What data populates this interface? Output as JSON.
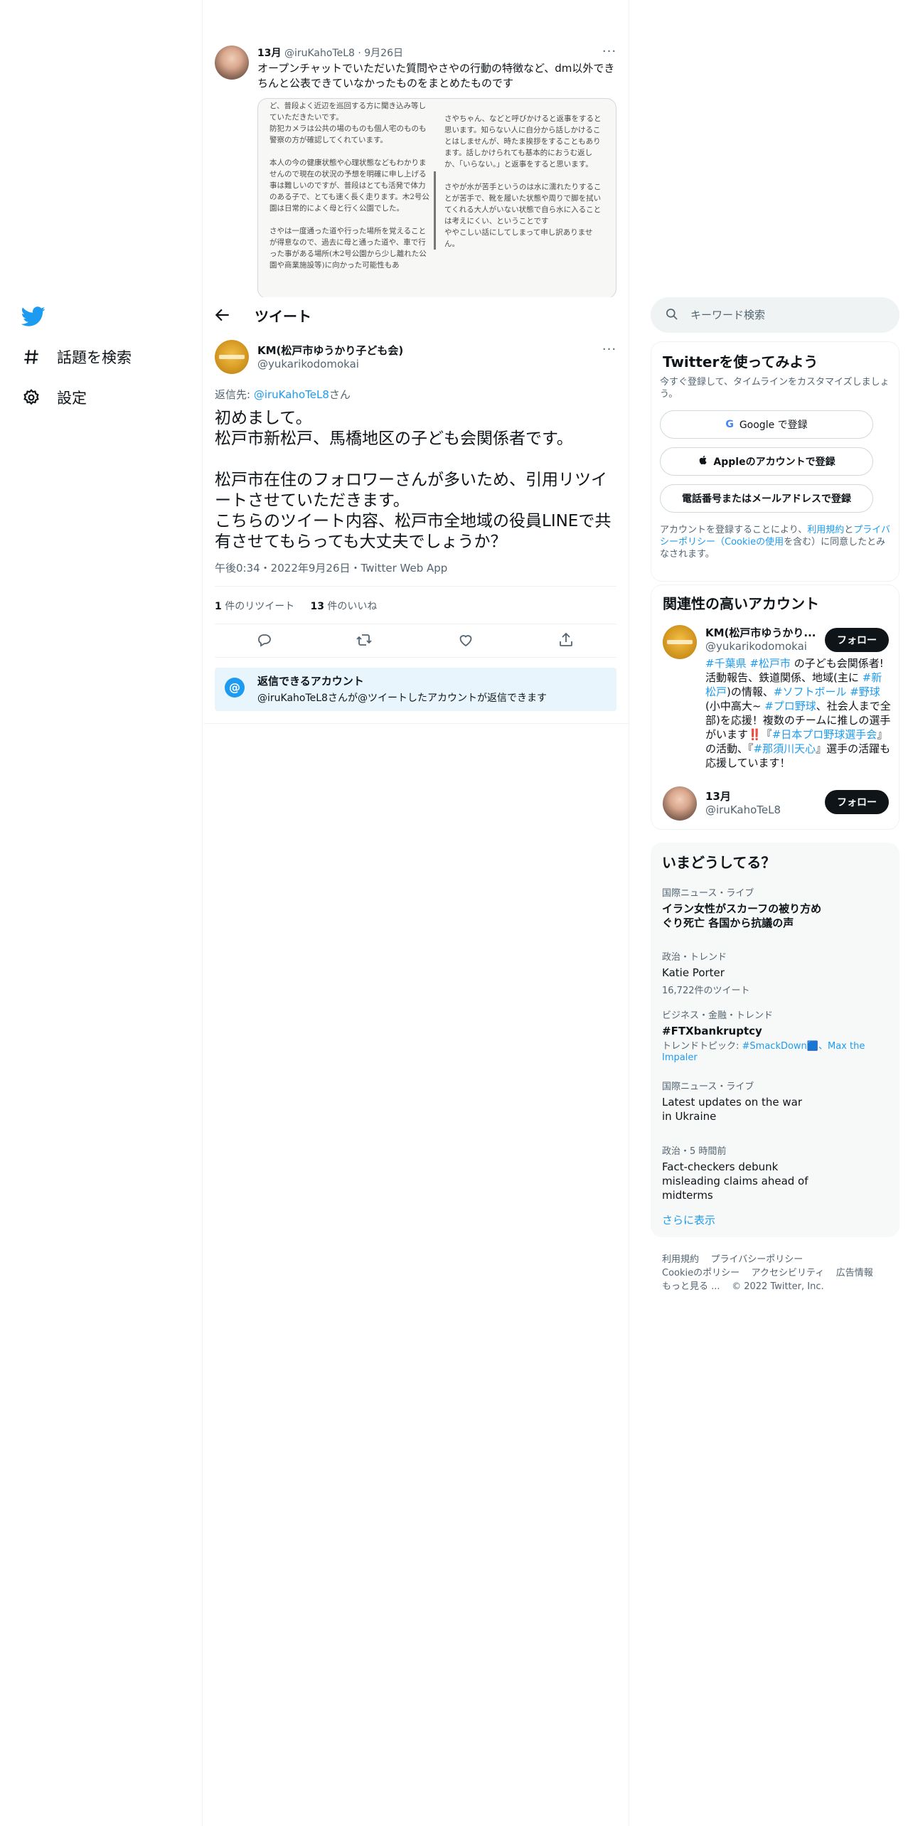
{
  "nav": {
    "logo": "twitter-bird-icon",
    "items": [
      {
        "label": "話題を検索",
        "icon": "hashtag-icon"
      },
      {
        "label": "設定",
        "icon": "gear-icon"
      }
    ]
  },
  "quoted_tweet": {
    "name": "13月",
    "handle": "@iruKahoTeL8",
    "date": "9月26日",
    "text": "オープンチャットでいただいた質問やさやの行動の特徴など、dm以外できちんと公表できていなかったものをまとめたものです",
    "image_left": "ど、普段よく近辺を巡回する方に聞き込み等していただきたいです。\n防犯カメラは公共の場のものも個人宅のものも警察の方が確認してくれています。\n\n本人の今の健康状態や心理状態などもわかりませんので現在の状況の予想を明確に申し上げる事は難しいのですが、普段はとても活発で体力のある子で、とても速く長く走ります。木2号公園は日常的によく母と行く公園でした。\n\nさやは一度通った道や行った場所を覚えることが得意なので、過去に母と通った道や、車で行った事がある場所(木2号公園から少し離れた公園や商業施設等)に向かった可能性もあ",
    "image_right": "さやちゃん、などと呼びかけると返事をすると思います。知らない人に自分から話しかけることはしませんが、時たま挨拶をすることもあります。話しかけられても基本的におうむ返しか、「いらない。」と返事をすると思います。\n\nさやが水が苦手というのは水に濡れたりすることが苦手で、靴を履いた状態や周りで脚を拭いてくれる大人がいない状態で自ら水に入ることは考えにくい、ということです\nややこしい話にしてしまって申し訳ありません。"
  },
  "header": {
    "title": "ツイート"
  },
  "tweet": {
    "name": "KM(松戸市ゆうかり子ども会)",
    "handle": "@yukarikodomokai",
    "reply_prefix": "返信先: ",
    "reply_handle": "@iruKahoTeL8",
    "reply_suffix": "さん",
    "body": "初めまして。\n松戸市新松戸、馬橋地区の子ども会関係者です。\n\n松戸市在住のフォロワーさんが多いため、引用リツイートさせていただきます。\nこちらのツイート内容、松戸市全地域の役員LINEで共有させてもらっても大丈夫でしょうか？",
    "meta": "午後0:34・2022年9月26日・Twitter Web App",
    "retweets_count": "1",
    "retweets_label": "件のリツイート",
    "likes_count": "13",
    "likes_label": "件のいいね",
    "actions": [
      "reply-icon",
      "retweet-icon",
      "like-icon",
      "share-icon"
    ]
  },
  "reply_notice": {
    "title": "返信できるアカウント",
    "desc": "@iruKahoTeL8さんが@ツイートしたアカウントが返信できます"
  },
  "search": {
    "placeholder": "キーワード検索"
  },
  "signup": {
    "title": "Twitterを使ってみよう",
    "subtitle": "今すぐ登録して、タイムラインをカスタマイズしましょう。",
    "google": "Google で登録",
    "apple": "Appleのアカウントで登録",
    "phone": "電話番号またはメールアドレスで登録",
    "terms_pre": "アカウントを登録することにより、",
    "terms_link1": "利用規約",
    "terms_mid1": "と",
    "terms_link2": "プライバシーポリシー（Cookieの使用",
    "terms_post": "を含む）に同意したとみなされます。"
  },
  "relevant": {
    "title": "関連性の高いアカウント",
    "accounts": [
      {
        "name": "KM(松戸市ゆうかり...",
        "handle": "@yukarikodomokai",
        "follow": "フォロー"
      },
      {
        "name": "13月",
        "handle": "@iruKahoTeL8",
        "follow": "フォロー"
      }
    ]
  },
  "trends": {
    "title": "いまどうしてる？",
    "items": [
      {
        "category": "国際ニュース・ライブ",
        "title": "イラン女性がスカーフの被り方めぐり死亡 各国から抗議の声"
      },
      {
        "category": "政治・トレンド",
        "title": "Katie Porter",
        "sub": "16,722件のツイート"
      },
      {
        "category": "ビジネス・金融・トレンド",
        "title": "#FTXbankruptcy",
        "sub_prefix": "トレンドトピック: ",
        "sub_links": "#SmackDown🟦、Max the Impaler"
      },
      {
        "category": "国際ニュース・ライブ",
        "title": "Latest updates on the war in Ukraine"
      },
      {
        "category": "政治・5 時間前",
        "title": "Fact-checkers debunk misleading claims ahead of midterms"
      }
    ],
    "show_more": "さらに表示"
  },
  "footer": {
    "links_row1": [
      "利用規約",
      "プライバシーポリシー"
    ],
    "links_row2": [
      "Cookieのポリシー",
      "アクセシビリティ",
      "広告情報"
    ],
    "more": "もっと見る ...",
    "copyright": "© 2022 Twitter, Inc."
  },
  "colors": {
    "accent": "#1d9bf0",
    "text": "#0f1419",
    "secondary": "#536471",
    "border": "#eff3f4"
  }
}
